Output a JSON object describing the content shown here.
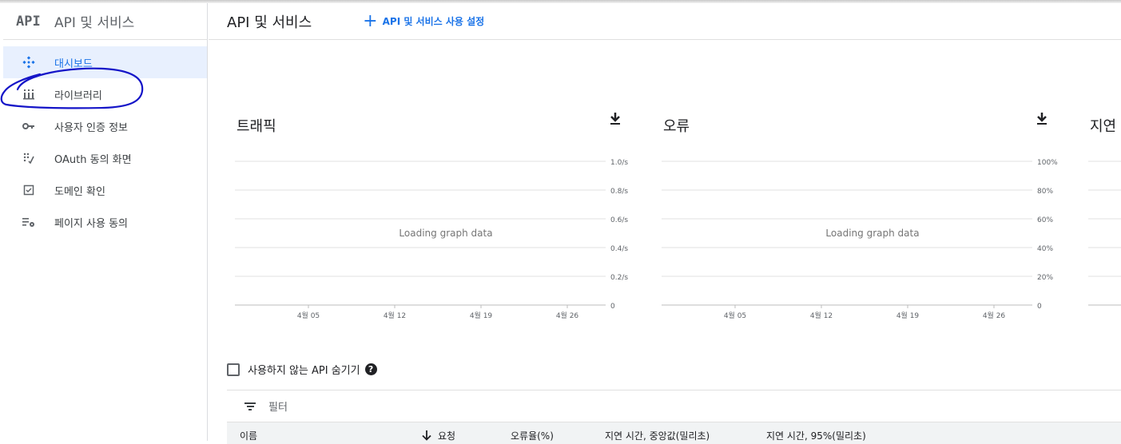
{
  "sidebar": {
    "logo": "API",
    "title": "API 및 서비스",
    "items": [
      {
        "label": "대시보드",
        "icon": "dashboard-icon",
        "active": true
      },
      {
        "label": "라이브러리",
        "icon": "library-icon",
        "active": false
      },
      {
        "label": "사용자 인증 정보",
        "icon": "key-icon",
        "active": false
      },
      {
        "label": "OAuth 동의 화면",
        "icon": "oauth-consent-icon",
        "active": false
      },
      {
        "label": "도메인 확인",
        "icon": "domain-check-icon",
        "active": false
      },
      {
        "label": "페이지 사용 동의",
        "icon": "page-usage-settings-icon",
        "active": false
      }
    ]
  },
  "header": {
    "title": "API 및 서비스",
    "enable_button": "API 및 서비스 사용 설정"
  },
  "colors": {
    "accent": "#1a73e8",
    "active_bg": "#e8f0fe",
    "annotation": "#1515c8"
  },
  "chart_data": [
    {
      "type": "line",
      "title": "트래픽",
      "status": "Loading graph data",
      "x_ticks": [
        "4월 05",
        "4월 12",
        "4월 19",
        "4월 26"
      ],
      "y_ticks": [
        "1.0/s",
        "0.8/s",
        "0.6/s",
        "0.4/s",
        "0.2/s",
        "0"
      ],
      "ylim": [
        0,
        1.0
      ],
      "series": []
    },
    {
      "type": "line",
      "title": "오류",
      "status": "Loading graph data",
      "x_ticks": [
        "4월 05",
        "4월 12",
        "4월 19",
        "4월 26"
      ],
      "y_ticks": [
        "100%",
        "80%",
        "60%",
        "40%",
        "20%",
        "0"
      ],
      "ylim": [
        0,
        100
      ],
      "series": []
    },
    {
      "type": "line",
      "title": "지연",
      "series": []
    }
  ],
  "hide_unused": {
    "label": "사용하지 않는 API 숨기기",
    "checked": false
  },
  "filter": {
    "label": "필터"
  },
  "table": {
    "columns": [
      "이름",
      "요청",
      "오류율(%)",
      "지연 시간, 중앙값(밀리초)",
      "지연 시간, 95%(밀리초)"
    ]
  }
}
